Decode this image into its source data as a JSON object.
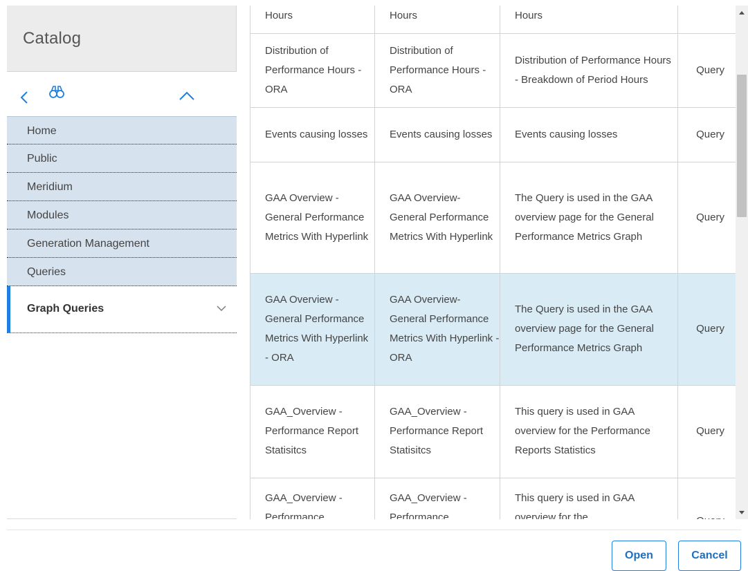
{
  "catalog": {
    "title": "Catalog",
    "toolbar_icons": [
      "chevron-left-icon",
      "binoculars-icon",
      "chevron-up-icon"
    ],
    "breadcrumbs": [
      {
        "label": "Home"
      },
      {
        "label": "Public"
      },
      {
        "label": "Meridium"
      },
      {
        "label": "Modules"
      },
      {
        "label": "Generation Management"
      },
      {
        "label": "Queries"
      }
    ],
    "current_folder": {
      "label": "Graph Queries",
      "icon": "chevron-down-icon"
    },
    "accent_color": "#1e7fe0",
    "breadcrumb_bg": "#d6e2ee"
  },
  "table": {
    "selected_row_color": "#d9ebf5",
    "rows": [
      {
        "name": "Hours",
        "caption": "Hours",
        "description": "Hours",
        "type": ""
      },
      {
        "name": "Distribution of Performance Hours - ORA",
        "caption": "Distribution of Performance Hours - ORA",
        "description": "Distribution of Performance Hours - Breakdown of Period Hours",
        "type": "Query"
      },
      {
        "name": "Events causing losses",
        "caption": "Events causing losses",
        "description": "Events causing losses",
        "type": "Query"
      },
      {
        "name": "GAA Overview - General Performance Metrics With Hyperlink",
        "caption": "GAA Overview- General Performance Metrics With Hyperlink",
        "description": "The Query is used in the GAA overview page for the General Performance Metrics Graph",
        "type": "Query"
      },
      {
        "name": "GAA Overview - General Performance Metrics With Hyperlink - ORA",
        "caption": "GAA Overview- General Performance Metrics With Hyperlink - ORA",
        "description": "The Query is used in the GAA overview page for the General Performance Metrics Graph",
        "type": "Query",
        "selected": true
      },
      {
        "name": "GAA_Overview - Performance Report Statisitcs",
        "caption": "GAA_Overview - Performance Report Statisitcs",
        "description": "This query is used in GAA overview for the Performance Reports Statistics",
        "type": "Query"
      },
      {
        "name": "GAA_Overview - Performance",
        "caption": "GAA_Overview - Performance",
        "description": "This query is used in GAA overview for the",
        "type": "Query"
      }
    ]
  },
  "scrollbar": {
    "up_icon": "scroll-up-arrow-icon",
    "down_icon": "scroll-down-arrow-icon"
  },
  "footer": {
    "open_label": "Open",
    "cancel_label": "Cancel"
  }
}
